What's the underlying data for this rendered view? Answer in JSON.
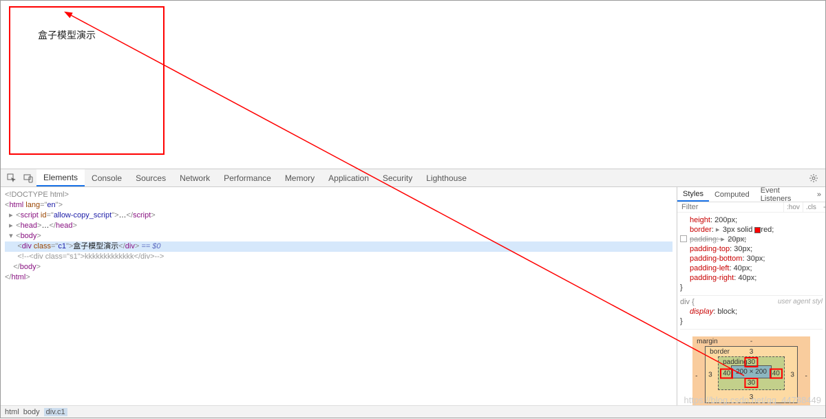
{
  "page": {
    "demo_text": "盒子模型演示"
  },
  "tabs": {
    "elements": "Elements",
    "console": "Console",
    "sources": "Sources",
    "network": "Network",
    "performance": "Performance",
    "memory": "Memory",
    "application": "Application",
    "security": "Security",
    "lighthouse": "Lighthouse"
  },
  "sidebar_tabs": {
    "styles": "Styles",
    "computed": "Computed",
    "event": "Event Listeners",
    "more": "»"
  },
  "filter": {
    "placeholder": "Filter",
    "hov": ":hov",
    "cls": ".cls",
    "plus": "+"
  },
  "dom": {
    "l1": "<!DOCTYPE html>",
    "l2a": "html",
    "l2b": "lang",
    "l2c": "en",
    "l3a": "script",
    "l3b": "id",
    "l3c": "allow-copy_script",
    "l3d": "…",
    "l4a": "head",
    "l4b": "…",
    "l5a": "body",
    "l6a": "div",
    "l6b": "class",
    "l6c": "c1",
    "l6d": "盒子模型演示",
    "l6e": " == $0",
    "l7": "<!--<div class=\"s1\">kkkkkkkkkkkkk</div>-->",
    "l8": "body",
    "l9": "html"
  },
  "rules": {
    "height": {
      "name": "height",
      "val": "200px;"
    },
    "border": {
      "name": "border",
      "val": "3px solid",
      "color": "red;"
    },
    "padding_sh": {
      "name": "padding",
      "val": "20px;"
    },
    "pt": {
      "name": "padding-top",
      "val": "30px;"
    },
    "pb": {
      "name": "padding-bottom",
      "val": "30px;"
    },
    "pl": {
      "name": "padding-left",
      "val": "40px;"
    },
    "pr": {
      "name": "padding-right",
      "val": "40px;"
    },
    "brace": "}",
    "ua_sel": "div {",
    "ua_src": "user agent styl",
    "display": {
      "name": "display",
      "val": "block;"
    }
  },
  "metrics": {
    "margin_label": "margin",
    "margin_val": "-",
    "border_label": "border",
    "border_val": "3",
    "padding_label": "padding",
    "pad_top": "30",
    "pad_bottom": "30",
    "pad_left": "40",
    "pad_right": "40",
    "content": "200 × 200"
  },
  "breadcrumb": {
    "p1": "html",
    "p2": "body",
    "p3": "div.c1"
  },
  "watermark": "https://blog.csdn.net/qq_44788449"
}
